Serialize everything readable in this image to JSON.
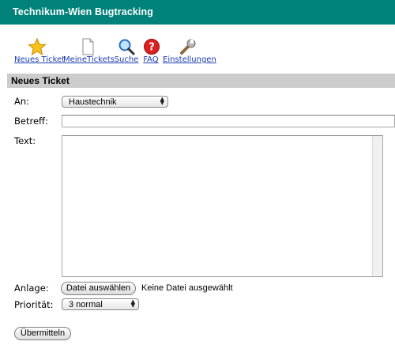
{
  "app_title": "Technikum-Wien Bugtracking",
  "nav": [
    {
      "label": "Neues Ticket",
      "icon": "star-icon"
    },
    {
      "label": "MeineTickets",
      "icon": "document-icon"
    },
    {
      "label": "Suche",
      "icon": "magnifier-icon"
    },
    {
      "label": "FAQ",
      "icon": "help-icon"
    },
    {
      "label": "Einstellungen",
      "icon": "wrench-icon"
    }
  ],
  "section_title": "Neues Ticket",
  "form": {
    "an_label": "An:",
    "an_value": "Haustechnik",
    "betreff_label": "Betreff:",
    "betreff_value": "",
    "text_label": "Text:",
    "text_value": "",
    "anlage_label": "Anlage:",
    "file_button": "Datei auswählen",
    "file_status": "Keine Datei ausgewählt",
    "prioritaet_label": "Priorität:",
    "prioritaet_value": "3 normal",
    "submit_label": "Übermitteln"
  },
  "colors": {
    "titlebar": "#00827a",
    "section_bar": "#cccccc",
    "link": "#1a3bb0"
  }
}
